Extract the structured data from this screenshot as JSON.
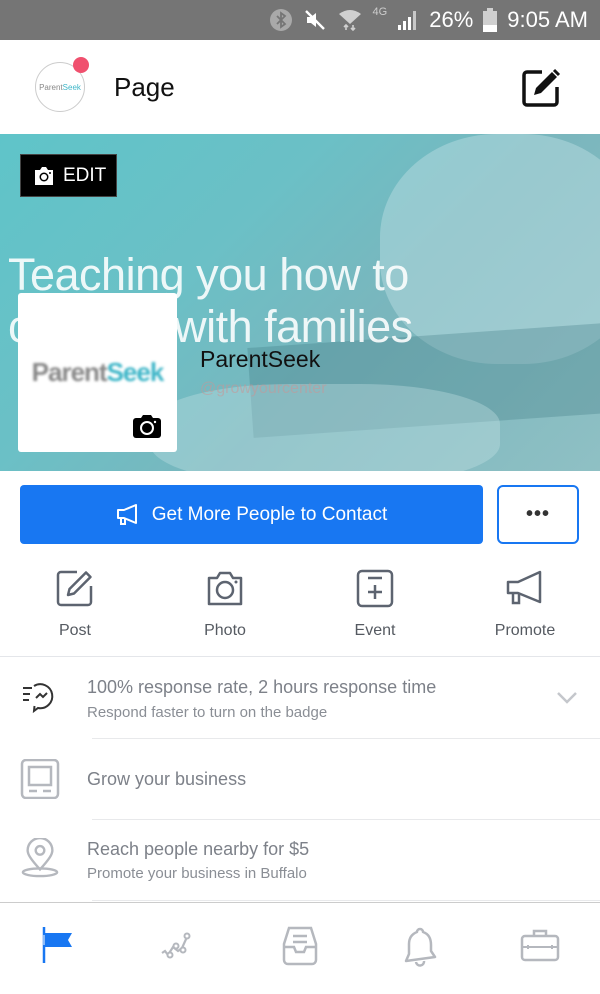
{
  "status_bar": {
    "network": "4G",
    "battery_percent": "26%",
    "time": "9:05 AM",
    "icons": [
      "bluetooth-icon",
      "mute-icon",
      "wifi-icon",
      "signal-icon",
      "battery-icon"
    ]
  },
  "header": {
    "avatar_text_part1": "Parent",
    "avatar_text_part2": "Seek",
    "title": "Page",
    "edit_icon": "compose-icon",
    "accent_notification": "#f0506e"
  },
  "cover": {
    "edit_label": "EDIT",
    "headline_line1": "Teaching you how to",
    "headline_line2": "connect with families",
    "page_name": "ParentSeek",
    "page_handle": "@growyourcenter",
    "logo_part1": "Parent",
    "logo_part2": "Seek"
  },
  "cta": {
    "label": "Get More People to Contact",
    "more_label": "•••",
    "accent": "#1877f2"
  },
  "actions": [
    {
      "label": "Post",
      "icon": "compose-icon"
    },
    {
      "label": "Photo",
      "icon": "camera-icon"
    },
    {
      "label": "Event",
      "icon": "calendar-plus-icon"
    },
    {
      "label": "Promote",
      "icon": "megaphone-icon"
    }
  ],
  "list": [
    {
      "primary": "100% response rate, 2 hours response time",
      "secondary": "Respond faster to turn on the badge",
      "icon": "fast-response-icon"
    },
    {
      "primary": "Grow your business",
      "icon": "monitor-icon"
    },
    {
      "primary": "Reach people nearby for $5",
      "secondary": "Promote your business in Buffalo",
      "icon": "location-pin-icon"
    }
  ],
  "tabbar": [
    {
      "name": "page",
      "icon": "flag-icon",
      "active": true
    },
    {
      "name": "insights",
      "icon": "insights-icon",
      "active": false
    },
    {
      "name": "inbox",
      "icon": "inbox-icon",
      "active": false
    },
    {
      "name": "notifications",
      "icon": "bell-icon",
      "active": false
    },
    {
      "name": "tools",
      "icon": "briefcase-icon",
      "active": false
    }
  ]
}
